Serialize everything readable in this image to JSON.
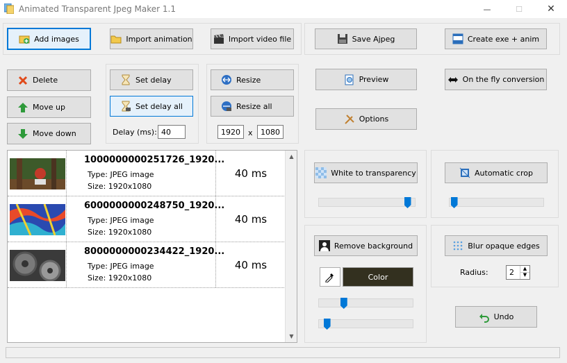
{
  "window": {
    "title": "Animated Transparent Jpeg Maker 1.1",
    "min": "—",
    "max": "☐",
    "close": "✕"
  },
  "toolbar": {
    "add_images": "Add images",
    "import_animation": "Import animation",
    "import_video": "Import video file",
    "save": "Save Ajpeg",
    "create_exe": "Create exe + anim"
  },
  "edit": {
    "delete": "Delete",
    "move_up": "Move up",
    "move_down": "Move down"
  },
  "delay": {
    "set_delay": "Set delay",
    "set_delay_all": "Set delay all",
    "label": "Delay (ms):",
    "value": "40"
  },
  "resize": {
    "resize": "Resize",
    "resize_all": "Resize all",
    "width": "1920",
    "x": "x",
    "height": "1080"
  },
  "actions": {
    "preview": "Preview",
    "options": "Options",
    "fly": "On the fly conversion"
  },
  "images": [
    {
      "name": "1000000000251726_1920...",
      "type": "Type: JPEG image",
      "size": "Size: 1920x1080",
      "delay": "40 ms"
    },
    {
      "name": "6000000000248750_1920...",
      "type": "Type: JPEG image",
      "size": "Size: 1920x1080",
      "delay": "40 ms"
    },
    {
      "name": "8000000000234422_1920...",
      "type": "Type: JPEG image",
      "size": "Size: 1920x1080",
      "delay": "40 ms"
    }
  ],
  "tools": {
    "white_transparency": "White to transparency",
    "auto_crop": "Automatic crop",
    "remove_bg": "Remove background",
    "color": "Color",
    "blur": "Blur opaque edges",
    "radius_label": "Radius:",
    "radius_value": "2",
    "undo": "Undo",
    "white_level": 0.95,
    "crop_level": 0.02,
    "bg_level_1": 0.25,
    "bg_level_2": 0.06
  },
  "colors": {
    "accent": "#0078d7",
    "color_swatch": "#33301f"
  }
}
